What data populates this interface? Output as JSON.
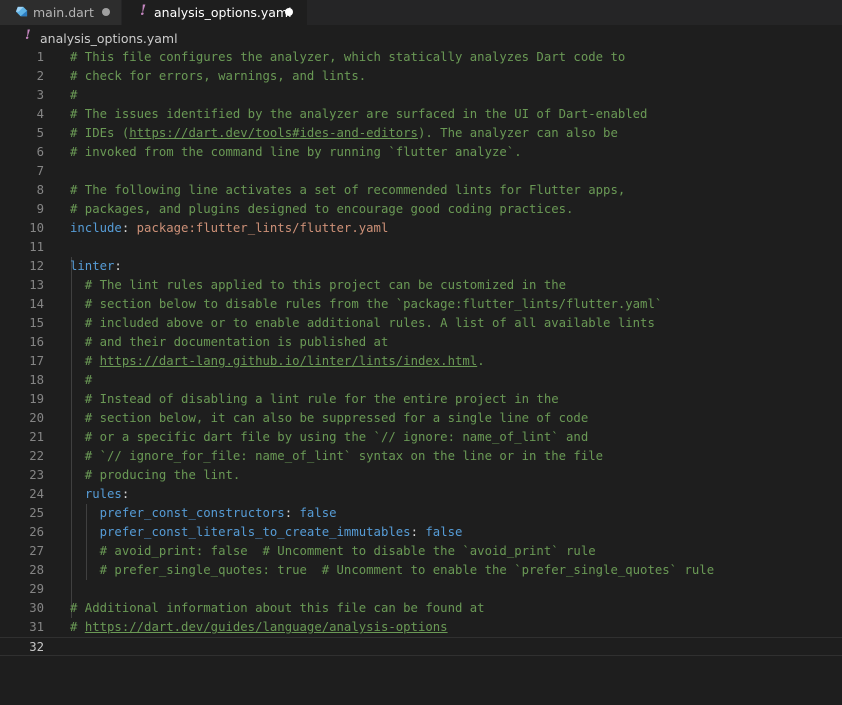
{
  "tabs": [
    {
      "label": "main.dart",
      "icon": "dart-icon",
      "active": false,
      "modified": true
    },
    {
      "label": "analysis_options.yaml",
      "icon": "yaml-icon",
      "active": true,
      "modified": true
    }
  ],
  "breadcrumb": {
    "icon_glyph": "!",
    "label": "analysis_options.yaml"
  },
  "tab_yaml_glyph": "!",
  "colors": {
    "comment": "#6a9955",
    "key": "#569cd6",
    "string": "#ce9178",
    "background": "#1e1e1e"
  },
  "editor": {
    "current_line": 32,
    "lines": [
      {
        "n": "1",
        "indent": 0,
        "parts": [
          {
            "t": "# This file configures the analyzer, which statically analyzes Dart code to",
            "c": "comment"
          }
        ]
      },
      {
        "n": "2",
        "indent": 0,
        "parts": [
          {
            "t": "# check for errors, warnings, and lints.",
            "c": "comment"
          }
        ]
      },
      {
        "n": "3",
        "indent": 0,
        "parts": [
          {
            "t": "#",
            "c": "comment"
          }
        ]
      },
      {
        "n": "4",
        "indent": 0,
        "parts": [
          {
            "t": "# The issues identified by the analyzer are surfaced in the UI of Dart-enabled",
            "c": "comment"
          }
        ]
      },
      {
        "n": "5",
        "indent": 0,
        "parts": [
          {
            "t": "# IDEs (",
            "c": "comment"
          },
          {
            "t": "https://dart.dev/tools#ides-and-editors",
            "c": "link"
          },
          {
            "t": "). The analyzer can also be",
            "c": "comment"
          }
        ]
      },
      {
        "n": "6",
        "indent": 0,
        "parts": [
          {
            "t": "# invoked from the command line by running `flutter analyze`.",
            "c": "comment"
          }
        ]
      },
      {
        "n": "7",
        "indent": 0,
        "parts": []
      },
      {
        "n": "8",
        "indent": 0,
        "parts": [
          {
            "t": "# The following line activates a set of recommended lints for Flutter apps,",
            "c": "comment"
          }
        ]
      },
      {
        "n": "9",
        "indent": 0,
        "parts": [
          {
            "t": "# packages, and plugins designed to encourage good coding practices.",
            "c": "comment"
          }
        ]
      },
      {
        "n": "10",
        "indent": 0,
        "parts": [
          {
            "t": "include",
            "c": "key"
          },
          {
            "t": ": ",
            "c": "punct"
          },
          {
            "t": "package:flutter_lints/flutter.yaml",
            "c": "val"
          }
        ]
      },
      {
        "n": "11",
        "indent": 0,
        "parts": []
      },
      {
        "n": "12",
        "indent": 0,
        "parts": [
          {
            "t": "linter",
            "c": "key"
          },
          {
            "t": ":",
            "c": "punct"
          }
        ]
      },
      {
        "n": "13",
        "indent": 1,
        "parts": [
          {
            "t": "  # The lint rules applied to this project can be customized in the",
            "c": "comment"
          }
        ]
      },
      {
        "n": "14",
        "indent": 1,
        "parts": [
          {
            "t": "  # section below to disable rules from the `package:flutter_lints/flutter.yaml`",
            "c": "comment"
          }
        ]
      },
      {
        "n": "15",
        "indent": 1,
        "parts": [
          {
            "t": "  # included above or to enable additional rules. A list of all available lints",
            "c": "comment"
          }
        ]
      },
      {
        "n": "16",
        "indent": 1,
        "parts": [
          {
            "t": "  # and their documentation is published at",
            "c": "comment"
          }
        ]
      },
      {
        "n": "17",
        "indent": 1,
        "parts": [
          {
            "t": "  # ",
            "c": "comment"
          },
          {
            "t": "https://dart-lang.github.io/linter/lints/index.html",
            "c": "link"
          },
          {
            "t": ".",
            "c": "comment"
          }
        ]
      },
      {
        "n": "18",
        "indent": 1,
        "parts": [
          {
            "t": "  #",
            "c": "comment"
          }
        ]
      },
      {
        "n": "19",
        "indent": 1,
        "parts": [
          {
            "t": "  # Instead of disabling a lint rule for the entire project in the",
            "c": "comment"
          }
        ]
      },
      {
        "n": "20",
        "indent": 1,
        "parts": [
          {
            "t": "  # section below, it can also be suppressed for a single line of code",
            "c": "comment"
          }
        ]
      },
      {
        "n": "21",
        "indent": 1,
        "parts": [
          {
            "t": "  # or a specific dart file by using the `// ignore: name_of_lint` and",
            "c": "comment"
          }
        ]
      },
      {
        "n": "22",
        "indent": 1,
        "parts": [
          {
            "t": "  # `// ignore_for_file: name_of_lint` syntax on the line or in the file",
            "c": "comment"
          }
        ]
      },
      {
        "n": "23",
        "indent": 1,
        "parts": [
          {
            "t": "  # producing the lint.",
            "c": "comment"
          }
        ]
      },
      {
        "n": "24",
        "indent": 1,
        "parts": [
          {
            "t": "  ",
            "c": "punct"
          },
          {
            "t": "rules",
            "c": "key"
          },
          {
            "t": ":",
            "c": "punct"
          }
        ]
      },
      {
        "n": "25",
        "indent": 2,
        "parts": [
          {
            "t": "    ",
            "c": "punct"
          },
          {
            "t": "prefer_const_constructors",
            "c": "key"
          },
          {
            "t": ": ",
            "c": "punct"
          },
          {
            "t": "false",
            "c": "key"
          }
        ]
      },
      {
        "n": "26",
        "indent": 2,
        "parts": [
          {
            "t": "    ",
            "c": "punct"
          },
          {
            "t": "prefer_const_literals_to_create_immutables",
            "c": "key"
          },
          {
            "t": ": ",
            "c": "punct"
          },
          {
            "t": "false",
            "c": "key"
          }
        ]
      },
      {
        "n": "27",
        "indent": 2,
        "parts": [
          {
            "t": "    # avoid_print: false  # Uncomment to disable the `avoid_print` rule",
            "c": "comment"
          }
        ]
      },
      {
        "n": "28",
        "indent": 2,
        "parts": [
          {
            "t": "    # prefer_single_quotes: true  # Uncomment to enable the `prefer_single_quotes` rule",
            "c": "comment"
          }
        ]
      },
      {
        "n": "29",
        "indent": 0,
        "parts": []
      },
      {
        "n": "30",
        "indent": 0,
        "parts": [
          {
            "t": "# Additional information about this file can be found at",
            "c": "comment"
          }
        ]
      },
      {
        "n": "31",
        "indent": 0,
        "parts": [
          {
            "t": "# ",
            "c": "comment"
          },
          {
            "t": "https://dart.dev/guides/language/analysis-options",
            "c": "link"
          }
        ]
      },
      {
        "n": "32",
        "indent": 0,
        "parts": []
      }
    ]
  }
}
